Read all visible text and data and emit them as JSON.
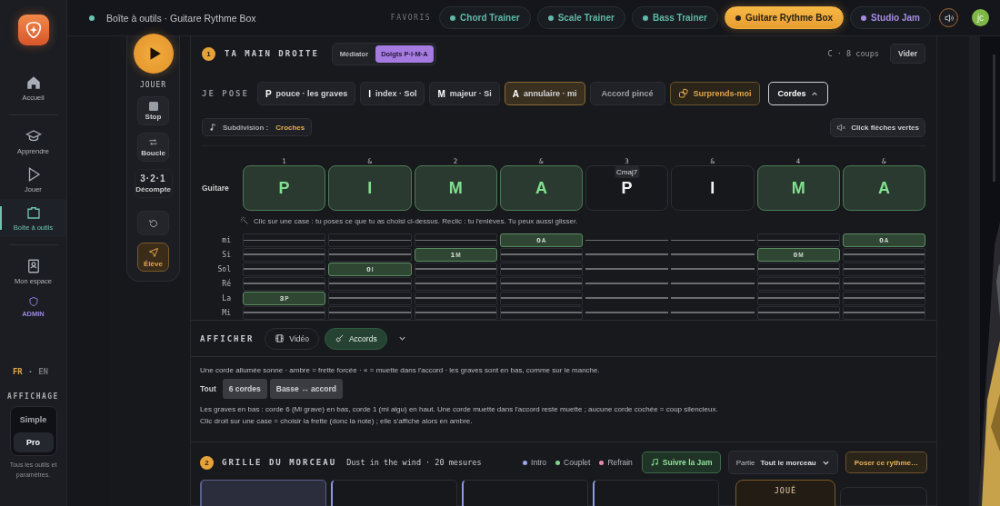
{
  "sidebar": {
    "nav": [
      {
        "label": "Accueil",
        "selected": false
      },
      {
        "label": "Apprendre",
        "selected": false
      },
      {
        "label": "Jouer",
        "selected": false
      },
      {
        "label": "Boîte à outils",
        "selected": true
      },
      {
        "label": "Mon espace",
        "selected": false
      },
      {
        "label": "ADMIN",
        "selected": false,
        "kind": "admin"
      }
    ],
    "languages": [
      {
        "label": "FR",
        "selected": true
      },
      {
        "label": "EN",
        "selected": false
      }
    ],
    "language_separator": "·",
    "display": {
      "title": "AFFICHAGE",
      "modes": [
        {
          "label": "Simple",
          "selected": false
        },
        {
          "label": "Pro",
          "selected": true
        }
      ],
      "note": "Tous les outils et paramètres."
    }
  },
  "topbar": {
    "breadcrumb": "Boîte à outils · Guitare Rythme Box",
    "favorites_label": "FAVORIS",
    "favorites": [
      {
        "label": "Chord Trainer",
        "color": "#5fb8a8",
        "selected": false
      },
      {
        "label": "Scale Trainer",
        "color": "#5fb8a8",
        "selected": false
      },
      {
        "label": "Bass Trainer",
        "color": "#5fb8a8",
        "selected": false
      },
      {
        "label": "Guitare Rythme Box",
        "color": "#2a2216",
        "selected": true
      },
      {
        "label": "Studio Jam",
        "color": "#a68be0",
        "selected": false
      }
    ],
    "avatar": "jc"
  },
  "transport": [
    {
      "kind": "play",
      "label": "JOUER"
    },
    {
      "kind": "stop",
      "label": "Stop"
    },
    {
      "kind": "loop",
      "label": "Boucle"
    },
    {
      "kind": "count",
      "label": "3·2·1",
      "sublabel": "Décompte"
    },
    {
      "kind": "reset"
    },
    {
      "kind": "student",
      "label": "Élève"
    }
  ],
  "right_hand": {
    "step": "1",
    "title": "TA MAIN DROITE",
    "modes": [
      {
        "label": "Médiator",
        "selected": false
      },
      {
        "label": "Doigts P·I·M·A",
        "selected": true
      }
    ],
    "summary": "C · 8 coups",
    "clear": "Vider"
  },
  "pose": {
    "label": "JE POSE",
    "chips": [
      {
        "kind": "finger",
        "key": "P",
        "label": "pouce · les graves",
        "selected": false
      },
      {
        "kind": "finger",
        "key": "I",
        "label": "index · Sol",
        "selected": false
      },
      {
        "kind": "finger",
        "key": "M",
        "label": "majeur · Si",
        "selected": false
      },
      {
        "kind": "finger",
        "key": "A",
        "label": "annulaire · mi",
        "selected": true
      },
      {
        "kind": "plain",
        "label": "Accord pincé"
      },
      {
        "kind": "random",
        "label": "Surprends-moi"
      },
      {
        "kind": "toggle",
        "label": "Cordes",
        "expanded": true
      }
    ]
  },
  "subdivision": {
    "label": "Subdivision :",
    "value": "Croches"
  },
  "click_button": "Click flèches vertes",
  "sequencer": {
    "track": "Guitare",
    "steps": [
      {
        "count": "1",
        "finger": "P",
        "active": true,
        "cells": [
          {
            "kind": "empty"
          },
          {
            "kind": "empty"
          },
          {
            "kind": "empty"
          },
          {
            "kind": "empty"
          },
          {
            "kind": "note",
            "fret": "3",
            "finger": "P"
          },
          {
            "kind": "empty"
          }
        ]
      },
      {
        "count": "&",
        "finger": "I",
        "active": true,
        "cells": [
          {
            "kind": "empty"
          },
          {
            "kind": "empty"
          },
          {
            "kind": "note",
            "fret": "0",
            "finger": "I"
          },
          {
            "kind": "empty"
          },
          {
            "kind": "empty"
          },
          {
            "kind": "empty"
          }
        ]
      },
      {
        "count": "2",
        "finger": "M",
        "active": true,
        "cells": [
          {
            "kind": "empty"
          },
          {
            "kind": "note",
            "fret": "1",
            "finger": "M"
          },
          {
            "kind": "empty"
          },
          {
            "kind": "empty"
          },
          {
            "kind": "empty"
          },
          {
            "kind": "empty"
          }
        ]
      },
      {
        "count": "&",
        "finger": "A",
        "active": true,
        "cells": [
          {
            "kind": "note",
            "fret": "0",
            "finger": "A"
          },
          {
            "kind": "empty"
          },
          {
            "kind": "empty"
          },
          {
            "kind": "empty"
          },
          {
            "kind": "empty"
          },
          {
            "kind": "empty"
          }
        ]
      },
      {
        "count": "3",
        "chord": "Cmaj7",
        "finger": "P",
        "active": false,
        "cells": [
          {
            "kind": "off"
          },
          {
            "kind": "off"
          },
          {
            "kind": "off"
          },
          {
            "kind": "off"
          },
          {
            "kind": "off"
          },
          {
            "kind": "off"
          }
        ]
      },
      {
        "count": "&",
        "finger": "I",
        "active": false,
        "cells": [
          {
            "kind": "off"
          },
          {
            "kind": "off"
          },
          {
            "kind": "off"
          },
          {
            "kind": "off"
          },
          {
            "kind": "off"
          },
          {
            "kind": "off"
          }
        ]
      },
      {
        "count": "4",
        "finger": "M",
        "active": true,
        "cells": [
          {
            "kind": "empty"
          },
          {
            "kind": "note",
            "fret": "0",
            "finger": "M"
          },
          {
            "kind": "empty"
          },
          {
            "kind": "empty"
          },
          {
            "kind": "empty"
          },
          {
            "kind": "empty"
          }
        ]
      },
      {
        "count": "&",
        "finger": "A",
        "active": true,
        "cells": [
          {
            "kind": "note",
            "fret": "0",
            "finger": "A"
          },
          {
            "kind": "empty"
          },
          {
            "kind": "empty"
          },
          {
            "kind": "empty"
          },
          {
            "kind": "empty"
          },
          {
            "kind": "empty"
          }
        ]
      }
    ],
    "hint": "Clic sur une case : tu poses ce que tu as choisi ci-dessus. Reclic : tu l'enlèves. Tu peux aussi glisser.",
    "strings": [
      "mi",
      "Si",
      "Sol",
      "Ré",
      "La",
      "Mi"
    ]
  },
  "display_bar": {
    "label": "AFFICHER",
    "options": [
      {
        "label": "Vidéo",
        "selected": false
      },
      {
        "label": "Accords",
        "selected": true
      }
    ]
  },
  "legend": "Une corde allumée sonne · ambre = frette forcée · × = muette dans l'accord · les graves sont en bas, comme sur le manche.",
  "presets": {
    "label": "Tout",
    "buttons": [
      "6 cordes",
      "Basse ↔ accord"
    ]
  },
  "explanations": [
    "Les graves en bas : corde 6 (Mi grave) en bas, corde 1 (mi aigu) en haut. Une corde muette dans l'accord reste muette ; aucune corde cochée = coup silencieux.",
    "Clic droit sur une case = choisir la frette (donc la note) ; elle s'affiche alors en ambre."
  ],
  "song_grid": {
    "step": "2",
    "title": "GRILLE DU MORCEAU",
    "song": "Dust in the wind · 20 mesures",
    "sections": [
      {
        "label": "Intro",
        "color": "#98a6ee"
      },
      {
        "label": "Couplet",
        "color": "#7fd48d"
      },
      {
        "label": "Refrain",
        "color": "#e68aa6"
      }
    ],
    "follow": "Suivre la Jam",
    "part_label": "Partie",
    "part_value": "Tout le morceau",
    "apply": "Poser ce rythme…",
    "bars": [
      {
        "selected": true
      },
      {
        "selected": false
      },
      {
        "selected": false
      },
      {
        "selected": false
      }
    ],
    "played_label": "JOUÉ"
  }
}
